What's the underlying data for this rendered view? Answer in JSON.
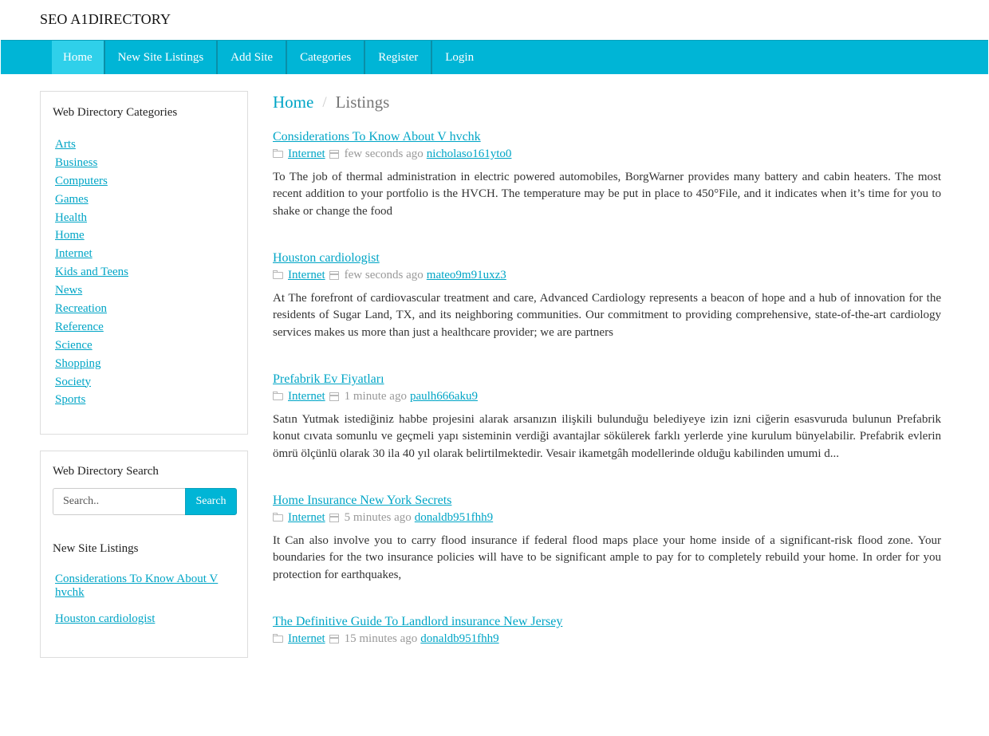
{
  "header": {
    "brand": "SEO A1DIRECTORY"
  },
  "nav": [
    {
      "label": "Home",
      "active": true
    },
    {
      "label": "New Site Listings"
    },
    {
      "label": "Add Site"
    },
    {
      "label": "Categories"
    },
    {
      "label": "Register"
    },
    {
      "label": "Login"
    }
  ],
  "categories_panel": {
    "title": "Web Directory Categories",
    "items": [
      "Arts",
      "Business",
      "Computers",
      "Games",
      "Health",
      "Home",
      "Internet",
      "Kids and Teens",
      "News",
      "Recreation",
      "Reference",
      "Science",
      "Shopping",
      "Society",
      "Sports"
    ]
  },
  "search_panel": {
    "title": "Web Directory Search",
    "placeholder": "Search..",
    "button": "Search"
  },
  "new_listings_panel": {
    "title": "New Site Listings",
    "items": [
      "Considerations To Know About V hvchk",
      "Houston cardiologist"
    ]
  },
  "breadcrumb": {
    "home": "Home",
    "separator": "/",
    "current": "Listings"
  },
  "listings": [
    {
      "title": "Considerations To Know About V hvchk",
      "category": "Internet",
      "time": "few seconds ago",
      "user": "nicholaso161yto0",
      "excerpt": "To The job of thermal administration in electric powered automobiles, BorgWarner provides many battery and cabin heaters. The most recent addition to your portfolio is the HVCH. The temperature may be put in place to 450°File, and it indicates when it’s time for you to shake or change the food"
    },
    {
      "title": "Houston cardiologist",
      "category": "Internet",
      "time": "few seconds ago",
      "user": "mateo9m91uxz3",
      "excerpt": "At The forefront of cardiovascular treatment and care, Advanced Cardiology represents a beacon of hope and a hub of innovation for the residents of Sugar Land, TX, and its neighboring communities. Our commitment to providing comprehensive, state-of-the-art cardiology services makes us more than just a healthcare provider; we are partners"
    },
    {
      "title": "Prefabrik Ev Fiyatları",
      "category": "Internet",
      "time": "1 minute ago",
      "user": "paulh666aku9",
      "excerpt": "Satın Yutmak istediğiniz habbe projesini alarak arsanızın ilişkili bulunduğu belediyeye izin izni ciğerin esasvuruda bulunun Prefabrik konut cıvata somunlu ve geçmeli yapı sisteminin verdiği avantajlar sökülerek farklı yerlerde yine kurulum bünyelabilir. Prefabrik evlerin ömrü ölçünlü olarak 30 ila 40 yıl olarak belirtilmektedir. Vesair ikametgâh modellerinde olduğu kabilinden umumi d..."
    },
    {
      "title": "Home Insurance New York Secrets",
      "category": "Internet",
      "time": "5 minutes ago",
      "user": "donaldb951fhh9",
      "excerpt": "It Can also involve you to carry flood insurance if federal flood maps place your home inside of a significant-risk flood zone. Your boundaries for the two insurance policies will have to be significant ample to pay for to completely rebuild your home. In order for you protection for earthquakes,"
    },
    {
      "title": "The Definitive Guide To Landlord insurance New Jersey",
      "category": "Internet",
      "time": "15 minutes ago",
      "user": "donaldb951fhh9",
      "excerpt": ""
    }
  ]
}
